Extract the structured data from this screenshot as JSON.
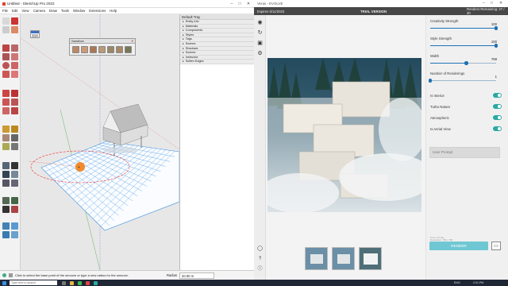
{
  "sketchup": {
    "title": "Untitled - SketchUp Pro 2022",
    "menu": [
      "File",
      "Edit",
      "View",
      "Camera",
      "Draw",
      "Tools",
      "Window",
      "Extensions",
      "Help"
    ],
    "tray": {
      "title": "Default Tray",
      "panels": [
        "Entity Info",
        "Materials",
        "Components",
        "Styles",
        "Tags",
        "Scenes",
        "Shadows",
        "Scenes",
        "Instructor",
        "Soften Edges"
      ]
    },
    "sandbox": {
      "title": "Sandbox"
    },
    "status": {
      "message": "Click to select the base point of the smoove or type a new radius for the smoove.",
      "radius_label": "Radius",
      "radius_value": "20.00 m"
    }
  },
  "veras": {
    "title": "Veras - EVOLVE",
    "expires": "Expires 6/11/2023",
    "version": "TRIAL VERSION",
    "renders_remaining": "Renders Remaining:  27 / 30",
    "settings": [
      {
        "label": "Creativity Strength",
        "value": "100",
        "fraction": 1.0
      },
      {
        "label": "Style Strength",
        "value": "100",
        "fraction": 1.0
      },
      {
        "label": "Width",
        "value": "768",
        "fraction": 0.55
      },
      {
        "label": "Number of Renderings",
        "value": "1",
        "fraction": 0.0
      }
    ],
    "toggles": [
      {
        "label": "Is Interior",
        "on": true
      },
      {
        "label": "Turbo Nature",
        "on": true
      },
      {
        "label": "Atmospheric",
        "on": true
      },
      {
        "label": "Is Aerial View",
        "on": true
      }
    ],
    "prompt_placeholder": "User Prompt",
    "render_info": [
      "Time: 0.5 Hrs",
      "Resolution: 768 x 768",
      "Creativity Strength: 100",
      "Style Strength: 100"
    ],
    "render_button": "RENDER"
  },
  "taskbar": {
    "search_placeholder": "Type here to search",
    "time": "2:01 PM",
    "language": "ENG"
  },
  "colors": {
    "accent": "#1c74b8",
    "toggle": "#2aa9a3",
    "render": "#6fc7d3",
    "veras_bar": "#474747",
    "grid": "#3a90e0"
  }
}
